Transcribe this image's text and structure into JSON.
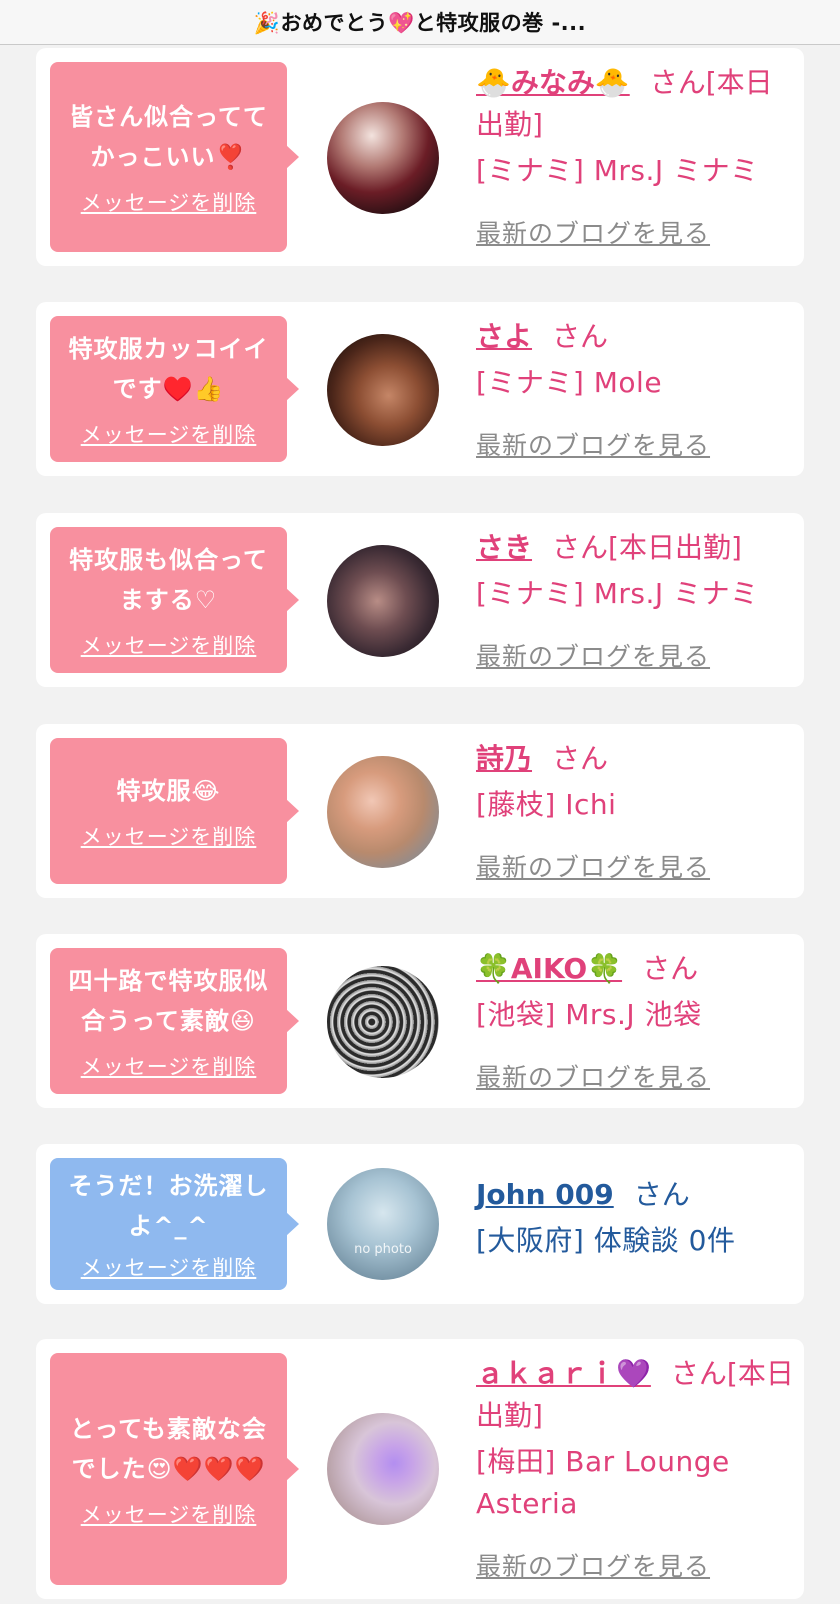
{
  "header": {
    "title": "🎉おめでとう💖と特攻服の巻 -..."
  },
  "delete_label": "メッセージを削除",
  "blog_label": "最新のブログを見る",
  "san": "さん",
  "cards": [
    {
      "message": "皆さん似合ってて かっこいい❣️",
      "name": "🐣みなみ🐣",
      "suffix": "[本日出勤]",
      "shop": "[ミナミ] Mrs.J ミナミ",
      "blog": true,
      "color": "pink"
    },
    {
      "message": "特攻服カッコイイ です♥️👍",
      "name": "さよ",
      "suffix": "",
      "shop": "[ミナミ] Mole",
      "blog": true,
      "color": "pink"
    },
    {
      "message": "特攻服も似合って まする♡",
      "name": "さき",
      "suffix": "[本日出勤]",
      "shop": "[ミナミ] Mrs.J ミナミ",
      "blog": true,
      "color": "pink"
    },
    {
      "message": "特攻服😂",
      "name": "詩乃",
      "suffix": "",
      "shop": "[藤枝] Ichi",
      "blog": true,
      "color": "pink"
    },
    {
      "message": "四十路で特攻服似 合うって素敵😆",
      "name": "🍀AIKO🍀",
      "suffix": "",
      "shop": "[池袋] Mrs.J 池袋",
      "blog": true,
      "color": "pink"
    },
    {
      "message": "そうだ！お洗濯し よ^_^",
      "name": "John 009",
      "suffix": "",
      "shop": "[大阪府] 体験談 0件",
      "blog": false,
      "color": "blue",
      "avatar_text": "no photo"
    },
    {
      "message": "とっても素敵な会 でした😍❤️❤️❤️",
      "name": "ａｋａｒｉ💜",
      "suffix": "[本日出勤]",
      "shop": "[梅田] Bar Lounge Asteria",
      "blog": true,
      "color": "pink"
    }
  ]
}
